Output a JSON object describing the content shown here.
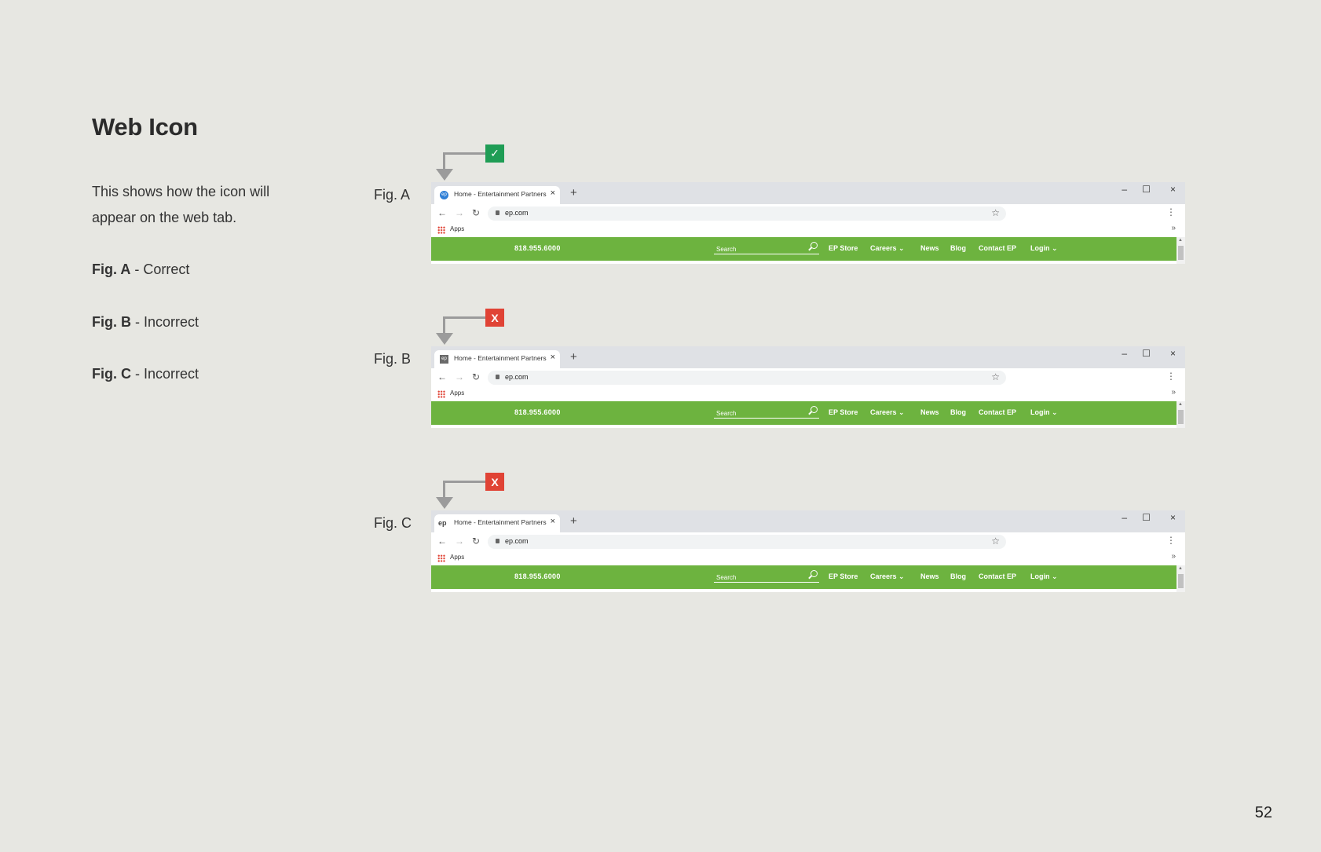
{
  "page": {
    "title": "Web Icon",
    "description": "This shows how the icon will appear on the web tab.",
    "legend": [
      {
        "fig": "Fig. A",
        "text": " - Correct"
      },
      {
        "fig": "Fig. B",
        "text": " - Incorrect"
      },
      {
        "fig": "Fig. C",
        "text": " - Incorrect"
      }
    ],
    "page_number": "52"
  },
  "figures": [
    {
      "label": "Fig. A",
      "status": "correct",
      "badge": "✓",
      "badge_color": "#1f9d55",
      "favicon": "ep-circle-blue-icon",
      "favicon_text": "ep"
    },
    {
      "label": "Fig. B",
      "status": "incorrect",
      "badge": "X",
      "badge_color": "#e04335",
      "favicon": "ep-square-grey-icon",
      "favicon_text": "ep"
    },
    {
      "label": "Fig. C",
      "status": "incorrect",
      "badge": "X",
      "badge_color": "#e04335",
      "favicon": "ep-wordmark-icon",
      "favicon_text": "ep"
    }
  ],
  "browser": {
    "tab_title": "Home - Entertainment Partners",
    "tab_close": "×",
    "new_tab": "+",
    "window_minimize": "–",
    "window_maximize": "☐",
    "window_close": "×",
    "back": "←",
    "forward": "→",
    "reload": "↻",
    "url": "ep.com",
    "star": "☆",
    "menu": "⋮",
    "bookmarks_apps": "Apps",
    "bookmarks_more": "»"
  },
  "site": {
    "phone": "818.955.6000",
    "search_placeholder": "Search",
    "nav": [
      "EP Store",
      "Careers ⌄",
      "News",
      "Blog",
      "Contact EP",
      "Login ⌄"
    ],
    "accent_color": "#6db33f"
  }
}
